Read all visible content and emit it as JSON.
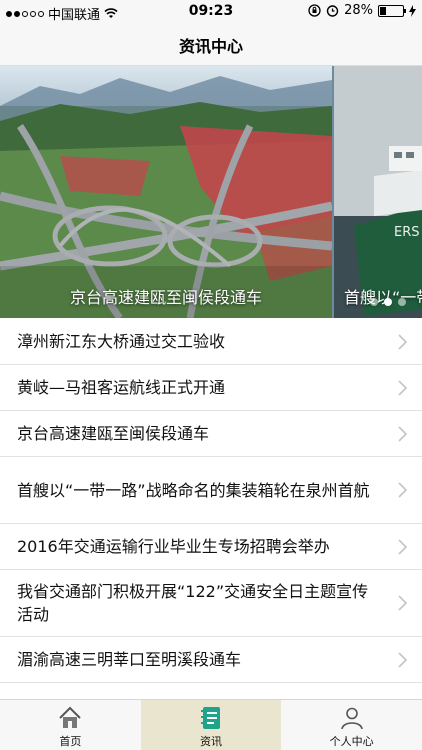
{
  "status_bar": {
    "carrier": "中国联通",
    "time": "09:23",
    "battery_percent": "28%",
    "battery_level": 0.28,
    "signal_dots": 5,
    "signal_filled": 2
  },
  "nav": {
    "title": "资讯中心"
  },
  "carousel": {
    "slides": [
      {
        "caption": "京台高速建瓯至闽侯段通车"
      },
      {
        "caption": "首艘以“一带"
      }
    ],
    "page_count": 3,
    "active_page": 1
  },
  "news": [
    {
      "title": "漳州新江东大桥通过交工验收"
    },
    {
      "title": "黄岐—马祖客运航线正式开通"
    },
    {
      "title": "京台高速建瓯至闽侯段通车"
    },
    {
      "title": "首艘以“一带一路”战略命名的集装箱轮在泉州首航"
    },
    {
      "title": "2016年交通运输行业毕业生专场招聘会举办"
    },
    {
      "title": "我省交通部门积极开展“122”交通安全日主题宣传活动"
    },
    {
      "title": "湄渝高速三明莘口至明溪段通车"
    }
  ],
  "tabs": [
    {
      "label": "首页",
      "icon": "home-icon"
    },
    {
      "label": "资讯",
      "icon": "notebook-icon",
      "active": true
    },
    {
      "label": "个人中心",
      "icon": "user-icon"
    }
  ],
  "colors": {
    "tab_active_bg": "#e9e5cf",
    "notebook_icon": "#1fa38a",
    "bar_bg": "#f7f7f7"
  }
}
